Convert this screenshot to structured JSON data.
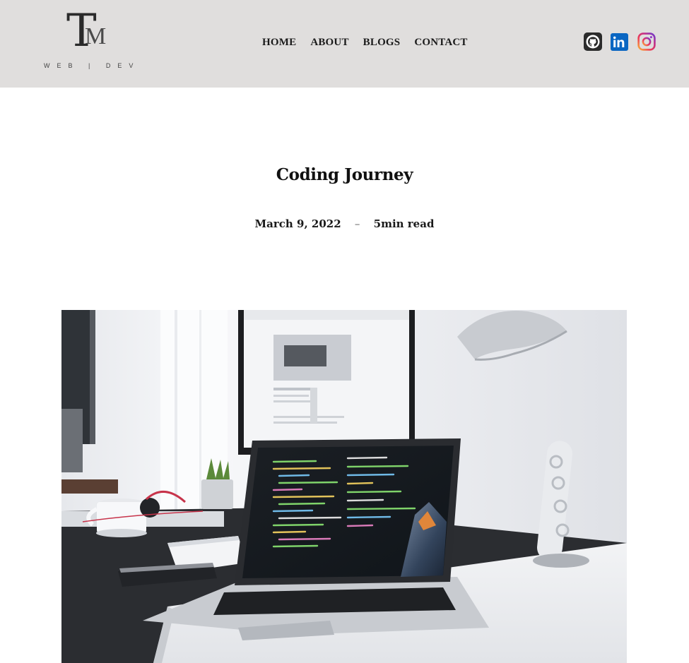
{
  "header": {
    "logo": {
      "letters": "TM",
      "tagline": "WEB | DEV"
    },
    "nav": [
      {
        "label": "HOME"
      },
      {
        "label": "ABOUT"
      },
      {
        "label": "BLOGS"
      },
      {
        "label": "CONTACT"
      }
    ],
    "social": [
      {
        "icon": "github-icon"
      },
      {
        "icon": "linkedin-icon",
        "text": "in"
      },
      {
        "icon": "instagram-icon"
      }
    ]
  },
  "article": {
    "title": "Coding Journey",
    "date": "March 9, 2022",
    "separator": "–",
    "read_time": "5min read",
    "hero_image": "desk-workspace-laptop-monitor-photo"
  },
  "colors": {
    "header_bg": "#e0dedd",
    "text": "#111111",
    "linkedin": "#0a66c2",
    "github": "#2b2b2b"
  }
}
